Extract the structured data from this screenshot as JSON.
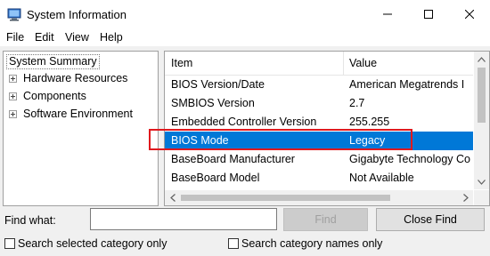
{
  "window": {
    "title": "System Information",
    "icon": "system-info-icon"
  },
  "menu": [
    "File",
    "Edit",
    "View",
    "Help"
  ],
  "tree": {
    "root": "System Summary",
    "children": [
      "Hardware Resources",
      "Components",
      "Software Environment"
    ]
  },
  "list": {
    "headers": {
      "item": "Item",
      "value": "Value"
    },
    "rows": [
      {
        "item": "BIOS Version/Date",
        "value": "American Megatrends I"
      },
      {
        "item": "SMBIOS Version",
        "value": "2.7"
      },
      {
        "item": "Embedded Controller Version",
        "value": "255.255"
      },
      {
        "item": "BIOS Mode",
        "value": "Legacy",
        "selected": true
      },
      {
        "item": "BaseBoard Manufacturer",
        "value": "Gigabyte Technology Co"
      },
      {
        "item": "BaseBoard Model",
        "value": "Not Available"
      }
    ]
  },
  "find": {
    "label": "Find what:",
    "value": "",
    "find_button": "Find",
    "close_button": "Close Find",
    "search_selected": "Search selected category only",
    "search_names": "Search category names only"
  },
  "colors": {
    "selection": "#0078d7",
    "highlight_border": "#e0191e"
  }
}
